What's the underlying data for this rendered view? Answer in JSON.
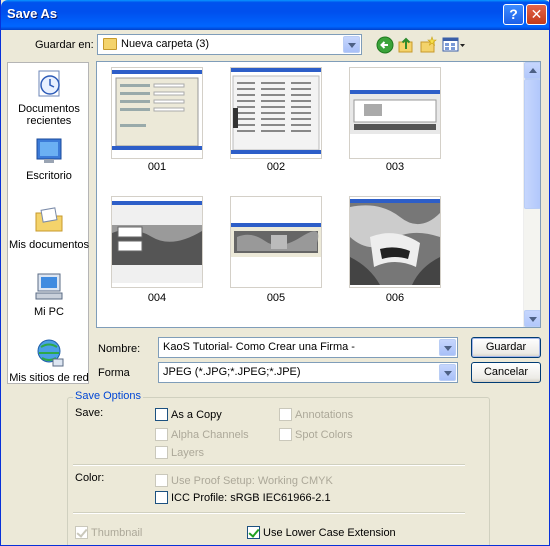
{
  "window": {
    "title": "Save As",
    "help_label": "?",
    "close_label": "✕"
  },
  "toolbar": {
    "save_in_label": "Guardar en:",
    "save_in_value": "Nueva carpeta (3)",
    "back_icon": "back-arrow-icon",
    "up_icon": "up-folder-icon",
    "new_folder_icon": "new-folder-icon",
    "views_icon": "views-menu-icon"
  },
  "places": [
    {
      "label": "Documentos recientes",
      "icon": "recent-documents-icon"
    },
    {
      "label": "Escritorio",
      "icon": "desktop-icon"
    },
    {
      "label": "Mis documentos",
      "icon": "my-documents-icon"
    },
    {
      "label": "Mi PC",
      "icon": "my-computer-icon"
    },
    {
      "label": "Mis sitios de red",
      "icon": "network-places-icon"
    }
  ],
  "files": [
    {
      "name": "001"
    },
    {
      "name": "002"
    },
    {
      "name": "003"
    },
    {
      "name": "004"
    },
    {
      "name": "005"
    },
    {
      "name": "006"
    }
  ],
  "form": {
    "name_label": "Nombre:",
    "name_value": "KaoS Tutorial- Como Crear una Firma -",
    "type_label": "Forma",
    "type_value": "JPEG (*.JPG;*.JPEG;*.JPE)",
    "save_button": "Guardar",
    "cancel_button": "Cancelar"
  },
  "save_options": {
    "group_title": "Save Options",
    "save_label": "Save:",
    "as_a_copy": "As a Copy",
    "annotations": "Annotations",
    "alpha_channels": "Alpha Channels",
    "spot_colors": "Spot Colors",
    "layers": "Layers",
    "color_label": "Color:",
    "use_proof_setup": "Use Proof Setup:  Working CMYK",
    "icc_profile": "ICC Profile:  sRGB IEC61966-2.1",
    "thumbnail": "Thumbnail",
    "lower_case_ext": "Use Lower Case Extension"
  },
  "colors": {
    "titlebar": "#0058ee",
    "window_bg": "#ece9d8",
    "group_title": "#0046d5"
  }
}
